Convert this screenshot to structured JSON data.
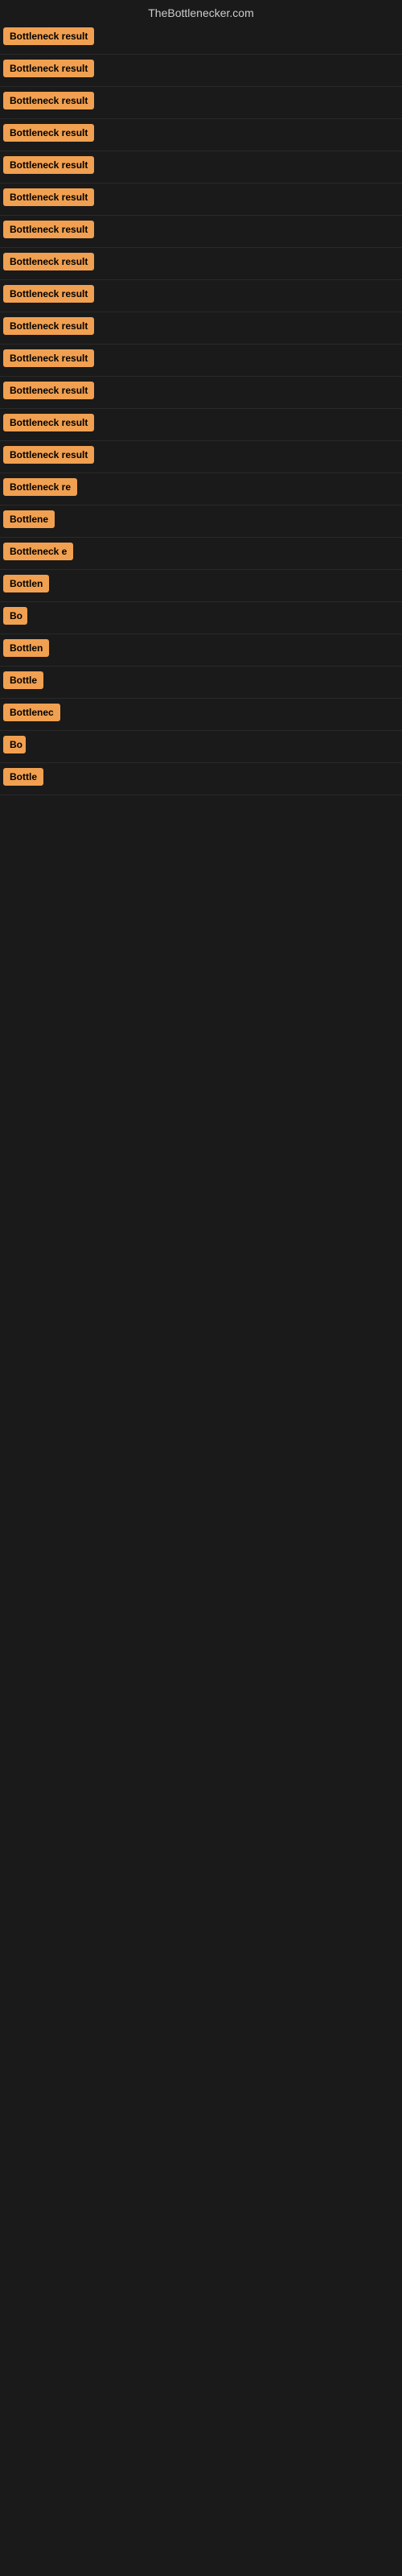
{
  "site": {
    "title": "TheBottlenecker.com"
  },
  "results": [
    {
      "id": 1,
      "label": "Bottleneck result",
      "width": 130
    },
    {
      "id": 2,
      "label": "Bottleneck result",
      "width": 130
    },
    {
      "id": 3,
      "label": "Bottleneck result",
      "width": 130
    },
    {
      "id": 4,
      "label": "Bottleneck result",
      "width": 130
    },
    {
      "id": 5,
      "label": "Bottleneck result",
      "width": 130
    },
    {
      "id": 6,
      "label": "Bottleneck result",
      "width": 130
    },
    {
      "id": 7,
      "label": "Bottleneck result",
      "width": 130
    },
    {
      "id": 8,
      "label": "Bottleneck result",
      "width": 130
    },
    {
      "id": 9,
      "label": "Bottleneck result",
      "width": 130
    },
    {
      "id": 10,
      "label": "Bottleneck result",
      "width": 130
    },
    {
      "id": 11,
      "label": "Bottleneck result",
      "width": 130
    },
    {
      "id": 12,
      "label": "Bottleneck result",
      "width": 130
    },
    {
      "id": 13,
      "label": "Bottleneck result",
      "width": 130
    },
    {
      "id": 14,
      "label": "Bottleneck result",
      "width": 130
    },
    {
      "id": 15,
      "label": "Bottleneck re",
      "width": 100
    },
    {
      "id": 16,
      "label": "Bottlene",
      "width": 80
    },
    {
      "id": 17,
      "label": "Bottleneck e",
      "width": 90
    },
    {
      "id": 18,
      "label": "Bottlen",
      "width": 65
    },
    {
      "id": 19,
      "label": "Bo",
      "width": 30
    },
    {
      "id": 20,
      "label": "Bottlen",
      "width": 65
    },
    {
      "id": 21,
      "label": "Bottle",
      "width": 55
    },
    {
      "id": 22,
      "label": "Bottlenec",
      "width": 75
    },
    {
      "id": 23,
      "label": "Bo",
      "width": 28
    },
    {
      "id": 24,
      "label": "Bottle",
      "width": 55
    }
  ]
}
